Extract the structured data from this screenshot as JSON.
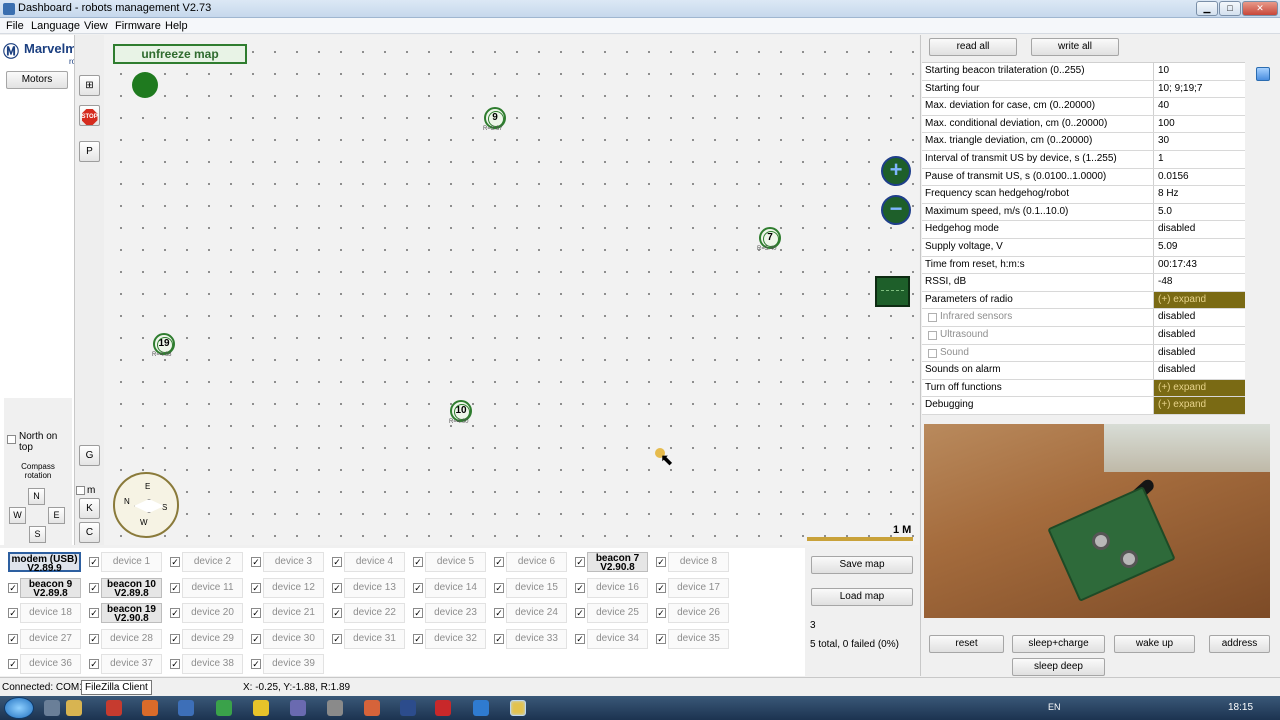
{
  "window": {
    "title": "Dashboard - robots management  V2.73"
  },
  "menu": [
    "File",
    "Language",
    "View",
    "Firmware",
    "Help"
  ],
  "logo": {
    "brand": "Marvelmind",
    "sub": "robotics"
  },
  "left": {
    "motors": "Motors",
    "stop_text": "STOP",
    "p_btn": "P",
    "g_btn": "G",
    "k_btn": "K",
    "c_btn": "C",
    "north_on_top": "North on top",
    "compass_rotation": "Compass rotation",
    "dirs": {
      "n": "N",
      "w": "W",
      "e": "E",
      "s": "S"
    },
    "m_label": "m"
  },
  "map": {
    "unfreeze": "unfreeze map",
    "beacons": [
      {
        "id": "9",
        "sub": "R=3.67"
      },
      {
        "id": "7",
        "sub": "R=5.40"
      },
      {
        "id": "19",
        "sub": "R=4.68"
      },
      {
        "id": "10",
        "sub": "R=4.00"
      }
    ],
    "scale": "1 M",
    "compass": {
      "e": "E",
      "n": "N",
      "s": "S",
      "w": "W"
    },
    "zoom_in": "+",
    "zoom_out": "−"
  },
  "devices": [
    {
      "label": "modem (USB)",
      "version": "V2.89.9"
    },
    {
      "label": "device 1"
    },
    {
      "label": "device 2"
    },
    {
      "label": "device 3"
    },
    {
      "label": "device 4"
    },
    {
      "label": "device 5"
    },
    {
      "label": "device 6"
    },
    {
      "label": "beacon 7",
      "version": "V2.90.8"
    },
    {
      "label": "device 8"
    },
    {
      "label": "beacon 9",
      "version": "V2.89.8"
    },
    {
      "label": "beacon 10",
      "version": "V2.89.8"
    },
    {
      "label": "device 11"
    },
    {
      "label": "device 12"
    },
    {
      "label": "device 13"
    },
    {
      "label": "device 14"
    },
    {
      "label": "device 15"
    },
    {
      "label": "device 16"
    },
    {
      "label": "device 17"
    },
    {
      "label": "device 18"
    },
    {
      "label": "beacon 19",
      "version": "V2.90.8"
    },
    {
      "label": "device 20"
    },
    {
      "label": "device 21"
    },
    {
      "label": "device 22"
    },
    {
      "label": "device 23"
    },
    {
      "label": "device 24"
    },
    {
      "label": "device 25"
    },
    {
      "label": "device 26"
    },
    {
      "label": "device 27"
    },
    {
      "label": "device 28"
    },
    {
      "label": "device 29"
    },
    {
      "label": "device 30"
    },
    {
      "label": "device 31"
    },
    {
      "label": "device 32"
    },
    {
      "label": "device 33"
    },
    {
      "label": "device 34"
    },
    {
      "label": "device 35"
    },
    {
      "label": "device 36"
    },
    {
      "label": "device 37"
    },
    {
      "label": "device 38"
    },
    {
      "label": "device 39"
    }
  ],
  "map_actions": {
    "save": "Save map",
    "load": "Load map",
    "count": "3",
    "summary": "5 total, 0 failed (0%)"
  },
  "right": {
    "read_all": "read all",
    "write_all": "write all",
    "properties": [
      {
        "name": "Starting beacon trilateration (0..255)",
        "value": "10"
      },
      {
        "name": "Starting four",
        "value": "10;  9;19;7"
      },
      {
        "name": "Max. deviation for case, cm (0..20000)",
        "value": "40"
      },
      {
        "name": "Max. conditional deviation, cm (0..20000)",
        "value": "100"
      },
      {
        "name": "Max. triangle deviation, cm (0..20000)",
        "value": "30"
      },
      {
        "name": "Interval of transmit US by device, s (1..255)",
        "value": "1"
      },
      {
        "name": "Pause of transmit US, s (0.0100..1.0000)",
        "value": "0.0156"
      },
      {
        "name": "Frequency scan hedgehog/robot",
        "value": "8 Hz"
      },
      {
        "name": "Maximum speed, m/s (0.1..10.0)",
        "value": "5.0"
      },
      {
        "name": "Hedgehog mode",
        "value": "disabled"
      },
      {
        "name": "Supply voltage, V",
        "value": "5.09"
      },
      {
        "name": "Time from reset, h:m:s",
        "value": "00:17:43"
      },
      {
        "name": "RSSI, dB",
        "value": "-48"
      },
      {
        "name": "Parameters of radio",
        "value": "(+) expand",
        "expand": true
      },
      {
        "name": "Infrared sensors",
        "value": "disabled",
        "sub": true
      },
      {
        "name": "Ultrasound",
        "value": "disabled",
        "sub": true
      },
      {
        "name": "Sound",
        "value": "disabled",
        "sub": true
      },
      {
        "name": "Sounds on alarm",
        "value": "disabled"
      },
      {
        "name": "Turn off functions",
        "value": "(+) expand",
        "expand": true
      },
      {
        "name": "Debugging",
        "value": "(+) expand",
        "expand": true
      }
    ],
    "actions": {
      "reset": "reset",
      "sleep_charge": "sleep+charge",
      "wake_up": "wake up",
      "address": "address",
      "sleep_deep": "sleep deep"
    }
  },
  "status": {
    "connected": "Connected: COM1",
    "tooltip": "FileZilla Client",
    "coords": "X: -0.25, Y:-1.88, R:1.89"
  },
  "taskbar": {
    "lang": "EN",
    "clock": "18:15"
  }
}
